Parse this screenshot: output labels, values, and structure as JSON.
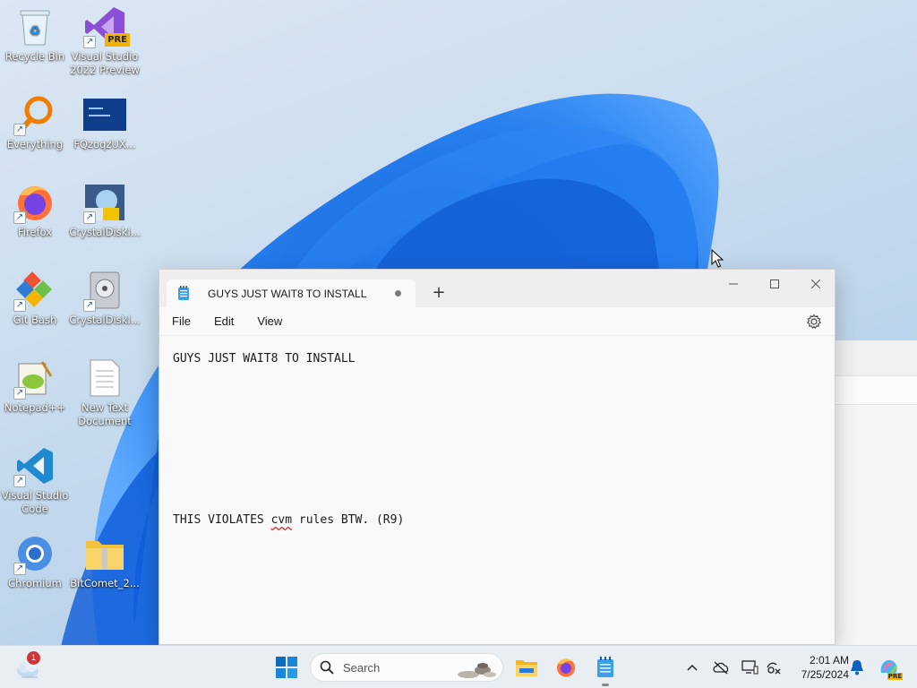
{
  "desktop": {
    "icons": [
      {
        "label": "Recycle Bin"
      },
      {
        "label": "Visual Studio 2022 Preview"
      },
      {
        "label": "Everything"
      },
      {
        "label": "FQzoqzUX..."
      },
      {
        "label": "Firefox"
      },
      {
        "label": "CrystalDiskI..."
      },
      {
        "label": "Git Bash"
      },
      {
        "label": "CrystalDiskI..."
      },
      {
        "label": "Notepad++"
      },
      {
        "label": "New Text Document"
      },
      {
        "label": "Visual Studio Code"
      },
      {
        "label": "Chromium"
      },
      {
        "label": "BitComet_2..."
      }
    ],
    "vs_badge": "PRE"
  },
  "notepad": {
    "tab_title": "GUYS JUST WAIT8 TO INSTALL",
    "new_tab_symbol": "+",
    "menu": {
      "file": "File",
      "edit": "Edit",
      "view": "View"
    },
    "content": {
      "line1": "GUYS JUST WAIT8 TO INSTALL",
      "line2_before": "THIS VIOLATES ",
      "line2_misspelled": "cvm",
      "line2_after": " rules BTW. (R9)"
    }
  },
  "taskbar": {
    "weather_badge": "1",
    "search_placeholder": "Search",
    "clock_time": "2:01 AM",
    "clock_date": "7/25/2024",
    "copilot_badge": "PRE"
  },
  "colors": {
    "accent": "#0067c0",
    "wallpaper_blue": "#1a73e8",
    "taskbar_bg": "#e9eef3"
  }
}
